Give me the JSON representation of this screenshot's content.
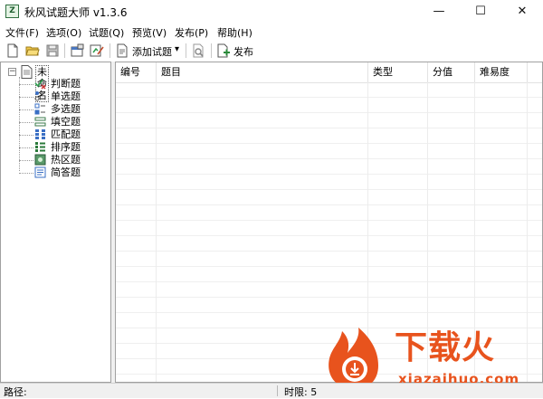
{
  "window": {
    "app_icon_text": "Z",
    "title": "秋风试题大师 v1.3.6",
    "minimize": "—",
    "maximize": "☐",
    "close": "✕"
  },
  "menu": [
    "文件(F)",
    "选项(O)",
    "试题(Q)",
    "预览(V)",
    "发布(P)",
    "帮助(H)"
  ],
  "toolbar": {
    "add_question_label": "添加试题",
    "add_dropdown_glyph": "▾",
    "publish_label": "发布"
  },
  "tree": {
    "expander": "−",
    "root": "未命名",
    "items": [
      "判断题",
      "单选题",
      "多选题",
      "填空题",
      "匹配题",
      "排序题",
      "热区题",
      "简答题"
    ]
  },
  "table": {
    "columns": [
      "编号",
      "题目",
      "类型",
      "分值",
      "难易度"
    ]
  },
  "status": {
    "path_label": "路径:",
    "time_label": "时限: 5"
  },
  "watermark": {
    "title": "下载火",
    "url": "xiazaihuo.com"
  },
  "colors": {
    "accent": "#e8531d",
    "border": "#a0a0a0"
  }
}
